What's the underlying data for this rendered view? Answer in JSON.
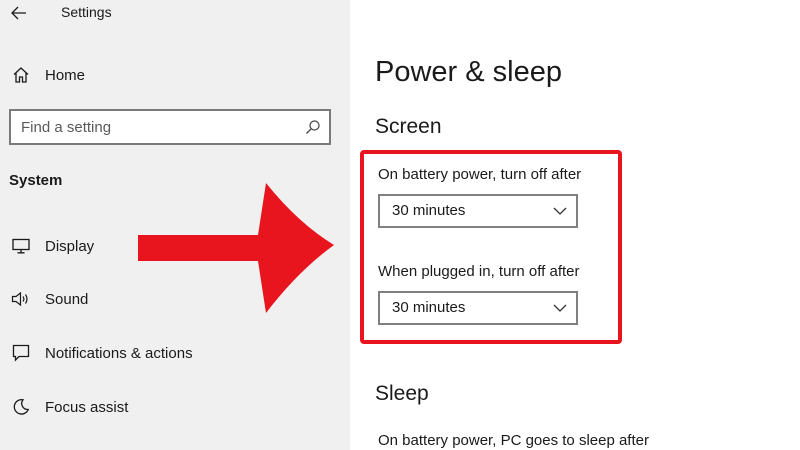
{
  "window": {
    "title": "Settings"
  },
  "sidebar": {
    "home_label": "Home",
    "search": {
      "placeholder": "Find a setting"
    },
    "section_heading": "System",
    "items": [
      {
        "label": "Display",
        "icon": "monitor-icon"
      },
      {
        "label": "Sound",
        "icon": "speaker-icon"
      },
      {
        "label": "Notifications & actions",
        "icon": "message-icon"
      },
      {
        "label": "Focus assist",
        "icon": "moon-icon"
      }
    ]
  },
  "main": {
    "page_title": "Power & sleep",
    "screen": {
      "heading": "Screen",
      "battery_label": "On battery power, turn off after",
      "battery_value": "30 minutes",
      "plugged_label": "When plugged in, turn off after",
      "plugged_value": "30 minutes"
    },
    "sleep": {
      "heading": "Sleep",
      "battery_label": "On battery power, PC goes to sleep after"
    }
  },
  "colors": {
    "highlight": "#e8141e",
    "arrow": "#e8141e",
    "sidebar_bg": "#f0f0f0"
  }
}
